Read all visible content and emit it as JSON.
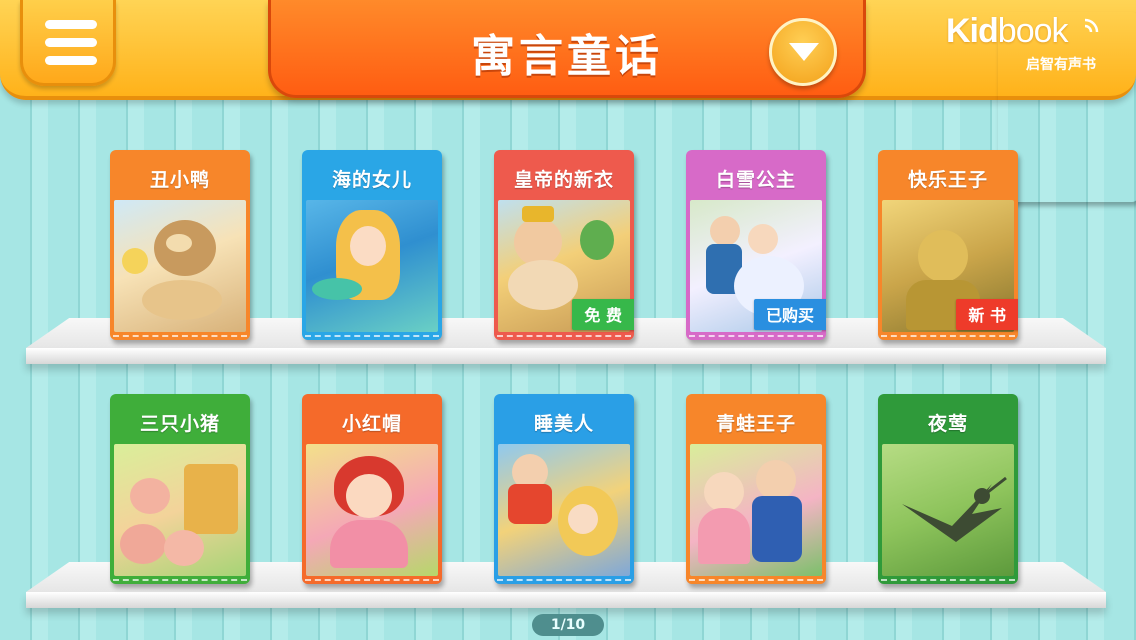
{
  "header": {
    "title": "寓言童话",
    "logo_main_1": "Kid",
    "logo_main_2": "book",
    "logo_sub": "启智有声书"
  },
  "shelves": [
    {
      "books": [
        {
          "title": "丑小鸭",
          "color": "#f7862a",
          "art": "duck",
          "badge": ""
        },
        {
          "title": "海的女儿",
          "color": "#2aa6e6",
          "art": "mermaid",
          "badge": ""
        },
        {
          "title": "皇帝的新衣",
          "color": "#ee5a4d",
          "art": "emperor",
          "badge": "免 费",
          "badge_color": "#37b84a"
        },
        {
          "title": "白雪公主",
          "color": "#d76ac8",
          "art": "snow",
          "badge": "已购买",
          "badge_color": "#2a8fe0"
        },
        {
          "title": "快乐王子",
          "color": "#f7862a",
          "art": "prince",
          "badge": "新 书",
          "badge_color": "#ee3b2a"
        }
      ]
    },
    {
      "books": [
        {
          "title": "三只小猪",
          "color": "#3fae3a",
          "art": "pigs",
          "badge": ""
        },
        {
          "title": "小红帽",
          "color": "#f56a2a",
          "art": "hood",
          "badge": ""
        },
        {
          "title": "睡美人",
          "color": "#2a9fe6",
          "art": "sleep",
          "badge": ""
        },
        {
          "title": "青蛙王子",
          "color": "#f7862a",
          "art": "frog",
          "badge": ""
        },
        {
          "title": "夜莺",
          "color": "#2f9a3a",
          "art": "bird",
          "badge": ""
        }
      ]
    }
  ],
  "pager": {
    "text": "1/10"
  }
}
